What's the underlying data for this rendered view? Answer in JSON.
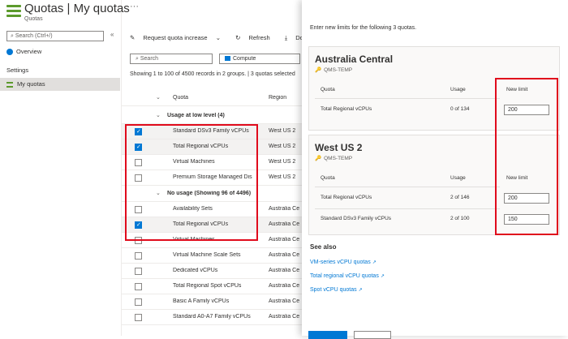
{
  "header": {
    "title": "Quotas | My quotas",
    "subtitle": "Quotas",
    "more": "···"
  },
  "nav": {
    "search_placeholder": "Search (Ctrl+/)",
    "collapse": "«",
    "overview": "Overview",
    "section": "Settings",
    "my_quotas": "My quotas"
  },
  "toolbar": {
    "request": "Request quota increase",
    "refresh": "Refresh",
    "download": "Download"
  },
  "filters": {
    "search_placeholder": "Search",
    "compute": "Compute"
  },
  "showing": "Showing 1 to 100 of 4500 records in 2 groups. | 3 quotas selected",
  "grid": {
    "headers": {
      "quota": "Quota",
      "region": "Region"
    },
    "rows": [
      {
        "type": "group",
        "name": "Usage at low level (4)"
      },
      {
        "type": "item",
        "name": "Standard DSv3 Family vCPUs",
        "region": "West US 2",
        "checked": true
      },
      {
        "type": "item",
        "name": "Total Regional vCPUs",
        "region": "West US 2",
        "checked": true
      },
      {
        "type": "item",
        "name": "Virtual Machines",
        "region": "West US 2",
        "checked": false
      },
      {
        "type": "item",
        "name": "Premium Storage Managed Dis",
        "region": "West US 2",
        "checked": false
      },
      {
        "type": "group",
        "name": "No usage (Showing 96 of 4496)"
      },
      {
        "type": "item",
        "name": "Availability Sets",
        "region": "Australia Ce",
        "checked": false
      },
      {
        "type": "item",
        "name": "Total Regional vCPUs",
        "region": "Australia Ce",
        "checked": true
      },
      {
        "type": "item",
        "name": "Virtual Machines",
        "region": "Australia Ce",
        "checked": false
      },
      {
        "type": "item",
        "name": "Virtual Machine Scale Sets",
        "region": "Australia Ce",
        "checked": false
      },
      {
        "type": "item",
        "name": "Dedicated vCPUs",
        "region": "Australia Ce",
        "checked": false
      },
      {
        "type": "item",
        "name": "Total Regional Spot vCPUs",
        "region": "Australia Ce",
        "checked": false
      },
      {
        "type": "item",
        "name": "Basic A Family vCPUs",
        "region": "Australia Ce",
        "checked": false
      },
      {
        "type": "item",
        "name": "Standard A0-A7 Family vCPUs",
        "region": "Australia Ce",
        "checked": false
      }
    ]
  },
  "panel": {
    "intro": "Enter new limits for the following 3 quotas.",
    "cols": {
      "quota": "Quota",
      "usage": "Usage",
      "new_limit": "New limit"
    },
    "regions": [
      {
        "title": "Australia Central",
        "sub": "QMS-TEMP",
        "rows": [
          {
            "quota": "Total Regional vCPUs",
            "usage": "0 of 134",
            "limit": "200"
          }
        ]
      },
      {
        "title": "West US 2",
        "sub": "QMS-TEMP",
        "rows": [
          {
            "quota": "Total Regional vCPUs",
            "usage": "2 of 146",
            "limit": "200"
          },
          {
            "quota": "Standard DSv3 Family vCPUs",
            "usage": "2 of 100",
            "limit": "150"
          }
        ]
      }
    ],
    "see_also": "See also",
    "links": [
      "VM-series vCPU quotas",
      "Total regional vCPU quotas",
      "Spot vCPU quotas"
    ]
  },
  "colors": {
    "accent": "#0078d4",
    "highlight": "#e00b1c",
    "brand": "#5c9a2c"
  }
}
